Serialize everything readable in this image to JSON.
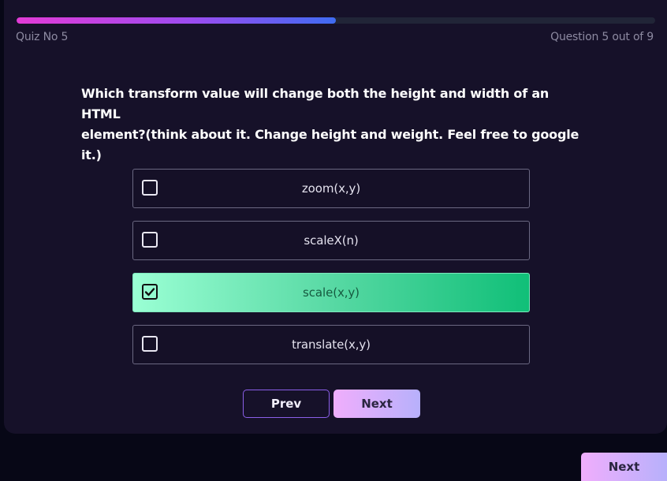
{
  "progress": {
    "fraction": 0.5
  },
  "header": {
    "quiz_label": "Quiz No 5",
    "question_counter": "Question 5 out of 9"
  },
  "question": {
    "line1": "Which transform value will change both the height and width of an HTML",
    "line2": "element?(think about it. Change height and weight. Feel free to google it.)"
  },
  "options": [
    {
      "label": "zoom(x,y)",
      "selected": false
    },
    {
      "label": "scaleX(n)",
      "selected": false
    },
    {
      "label": "scale(x,y)",
      "selected": true
    },
    {
      "label": "translate(x,y)",
      "selected": false
    }
  ],
  "buttons": {
    "prev_label": "Prev",
    "next_label": "Next",
    "floating_next_label": "Next"
  },
  "colors": {
    "selected_option": "#10bf78",
    "progress_start": "#e33bd6",
    "progress_end": "#3f6cf2"
  }
}
